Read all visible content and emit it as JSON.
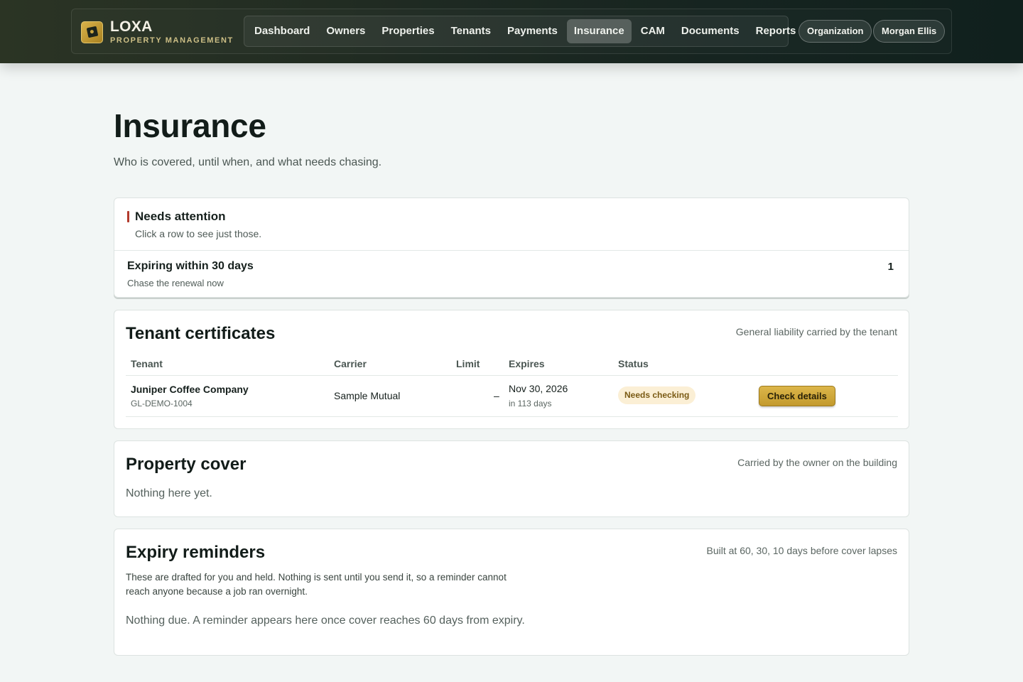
{
  "brand": {
    "name": "LOXA",
    "subtitle": "PROPERTY MANAGEMENT",
    "logo_icon": "building-block-icon",
    "accent_color": "#c9a43a"
  },
  "nav": {
    "items": [
      {
        "label": "Dashboard",
        "active": false
      },
      {
        "label": "Owners",
        "active": false
      },
      {
        "label": "Properties",
        "active": false
      },
      {
        "label": "Tenants",
        "active": false
      },
      {
        "label": "Payments",
        "active": false
      },
      {
        "label": "Insurance",
        "active": true
      },
      {
        "label": "CAM",
        "active": false
      },
      {
        "label": "Documents",
        "active": false
      },
      {
        "label": "Reports",
        "active": false
      }
    ],
    "organization_label": "Organization",
    "user_label": "Morgan Ellis"
  },
  "page": {
    "title": "Insurance",
    "subtitle": "Who is covered, until when, and what needs chasing."
  },
  "attention": {
    "title": "Needs attention",
    "subtitle": "Click a row to see just those.",
    "accent_color": "#b23a2c",
    "rows": [
      {
        "title": "Expiring within 30 days",
        "subtitle": "Chase the renewal now",
        "count": "1"
      }
    ]
  },
  "tenant_certificates": {
    "title": "Tenant certificates",
    "note": "General liability carried by the tenant",
    "columns": {
      "tenant": "Tenant",
      "carrier": "Carrier",
      "limit": "Limit",
      "expires": "Expires",
      "status": "Status"
    },
    "rows": [
      {
        "tenant": "Juniper Coffee Company",
        "policy": "GL-DEMO-1004",
        "carrier": "Sample Mutual",
        "limit": "–",
        "expires": "Nov 30, 2026",
        "expires_relative": "in 113 days",
        "status": "Needs checking",
        "action": "Check details"
      }
    ]
  },
  "property_cover": {
    "title": "Property cover",
    "note": "Carried by the owner on the building",
    "empty": "Nothing here yet."
  },
  "expiry_reminders": {
    "title": "Expiry reminders",
    "note": "Built at 60, 30, 10 days before cover lapses",
    "description": "These are drafted for you and held. Nothing is sent until you send it, so a reminder cannot reach anyone because a job ran overnight.",
    "empty": "Nothing due. A reminder appears here once cover reaches 60 days from expiry."
  }
}
